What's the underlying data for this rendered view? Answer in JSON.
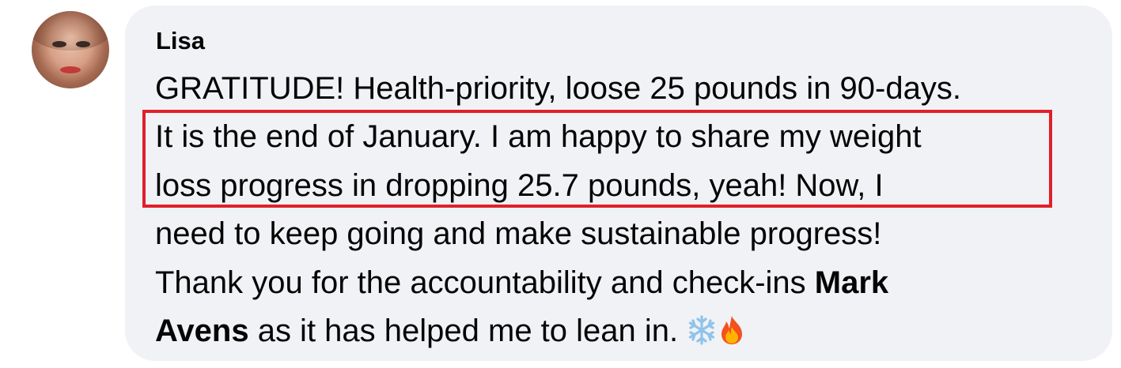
{
  "comment": {
    "author": "Lisa",
    "lines": [
      "GRATITUDE! Health-priority, loose 25 pounds in 90-days.",
      "It is the end of January. I am happy to share my weight",
      "loss progress in dropping 25.7 pounds, yeah! Now, I",
      "need to keep going and make sustainable progress!"
    ],
    "line5_text": "Thank you for the accountability and check-ins ",
    "mention_part1": "Mark",
    "mention_part2": "Avens",
    "line6_text": " as it has helped me to lean in. ",
    "emojis": [
      "snowflake-emoji",
      "fire-emoji"
    ]
  },
  "colors": {
    "bubble_bg": "#f0f2f5",
    "text": "#050505",
    "highlight_border": "#e0202a"
  }
}
